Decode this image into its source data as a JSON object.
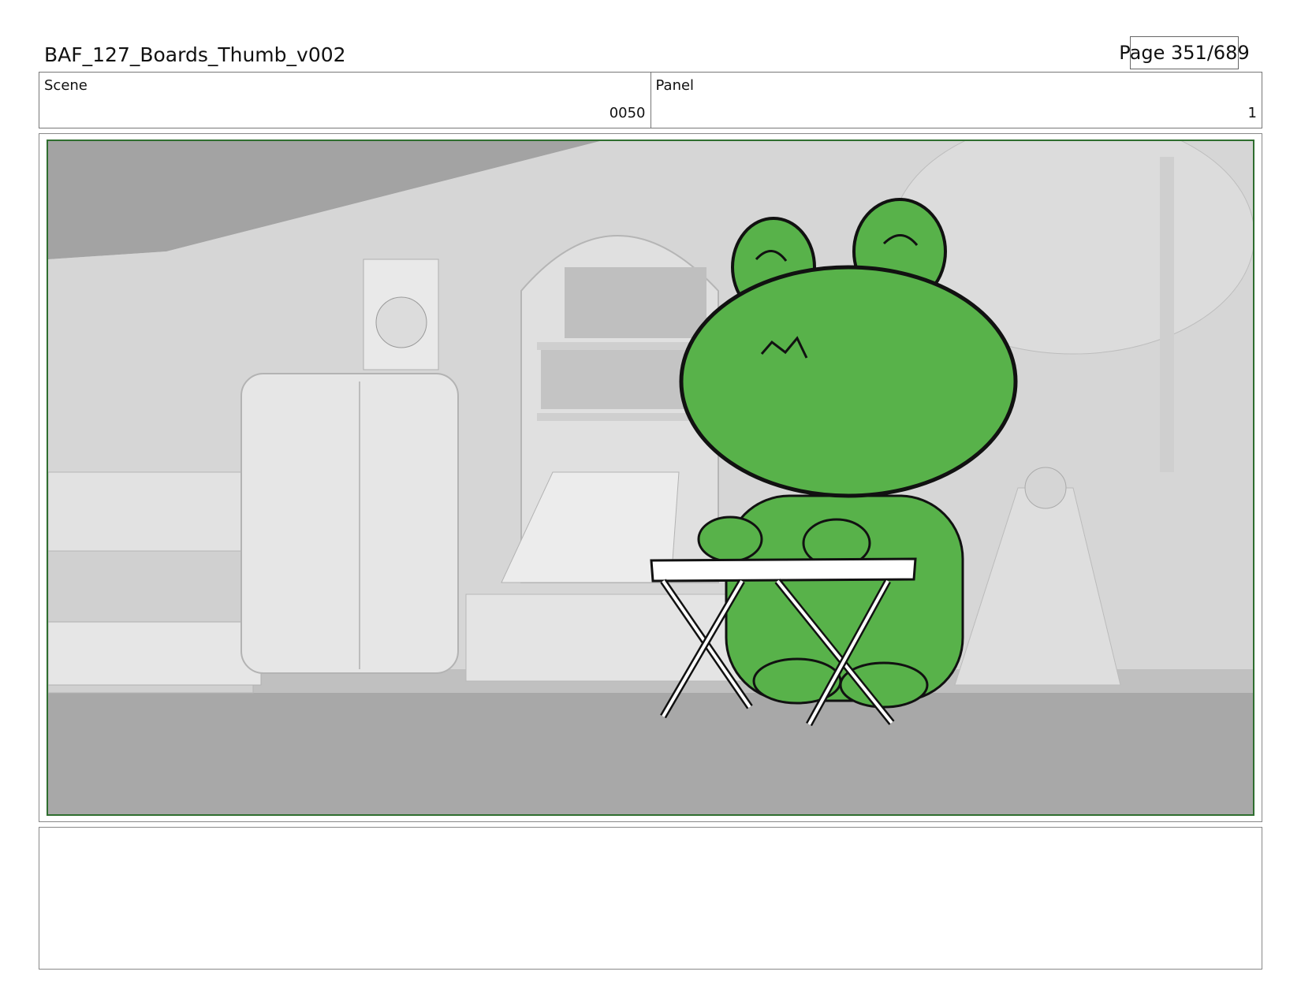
{
  "header": {
    "title": "BAF_127_Boards_Thumb_v002",
    "page": "Page 351/689"
  },
  "info": {
    "scene_label": "Scene",
    "scene_value": "0050",
    "panel_label": "Panel",
    "panel_value": "1"
  },
  "panel": {
    "frame_color": "#2f6e2f",
    "character_color": "#58b24a"
  },
  "notes": {
    "text": ""
  }
}
